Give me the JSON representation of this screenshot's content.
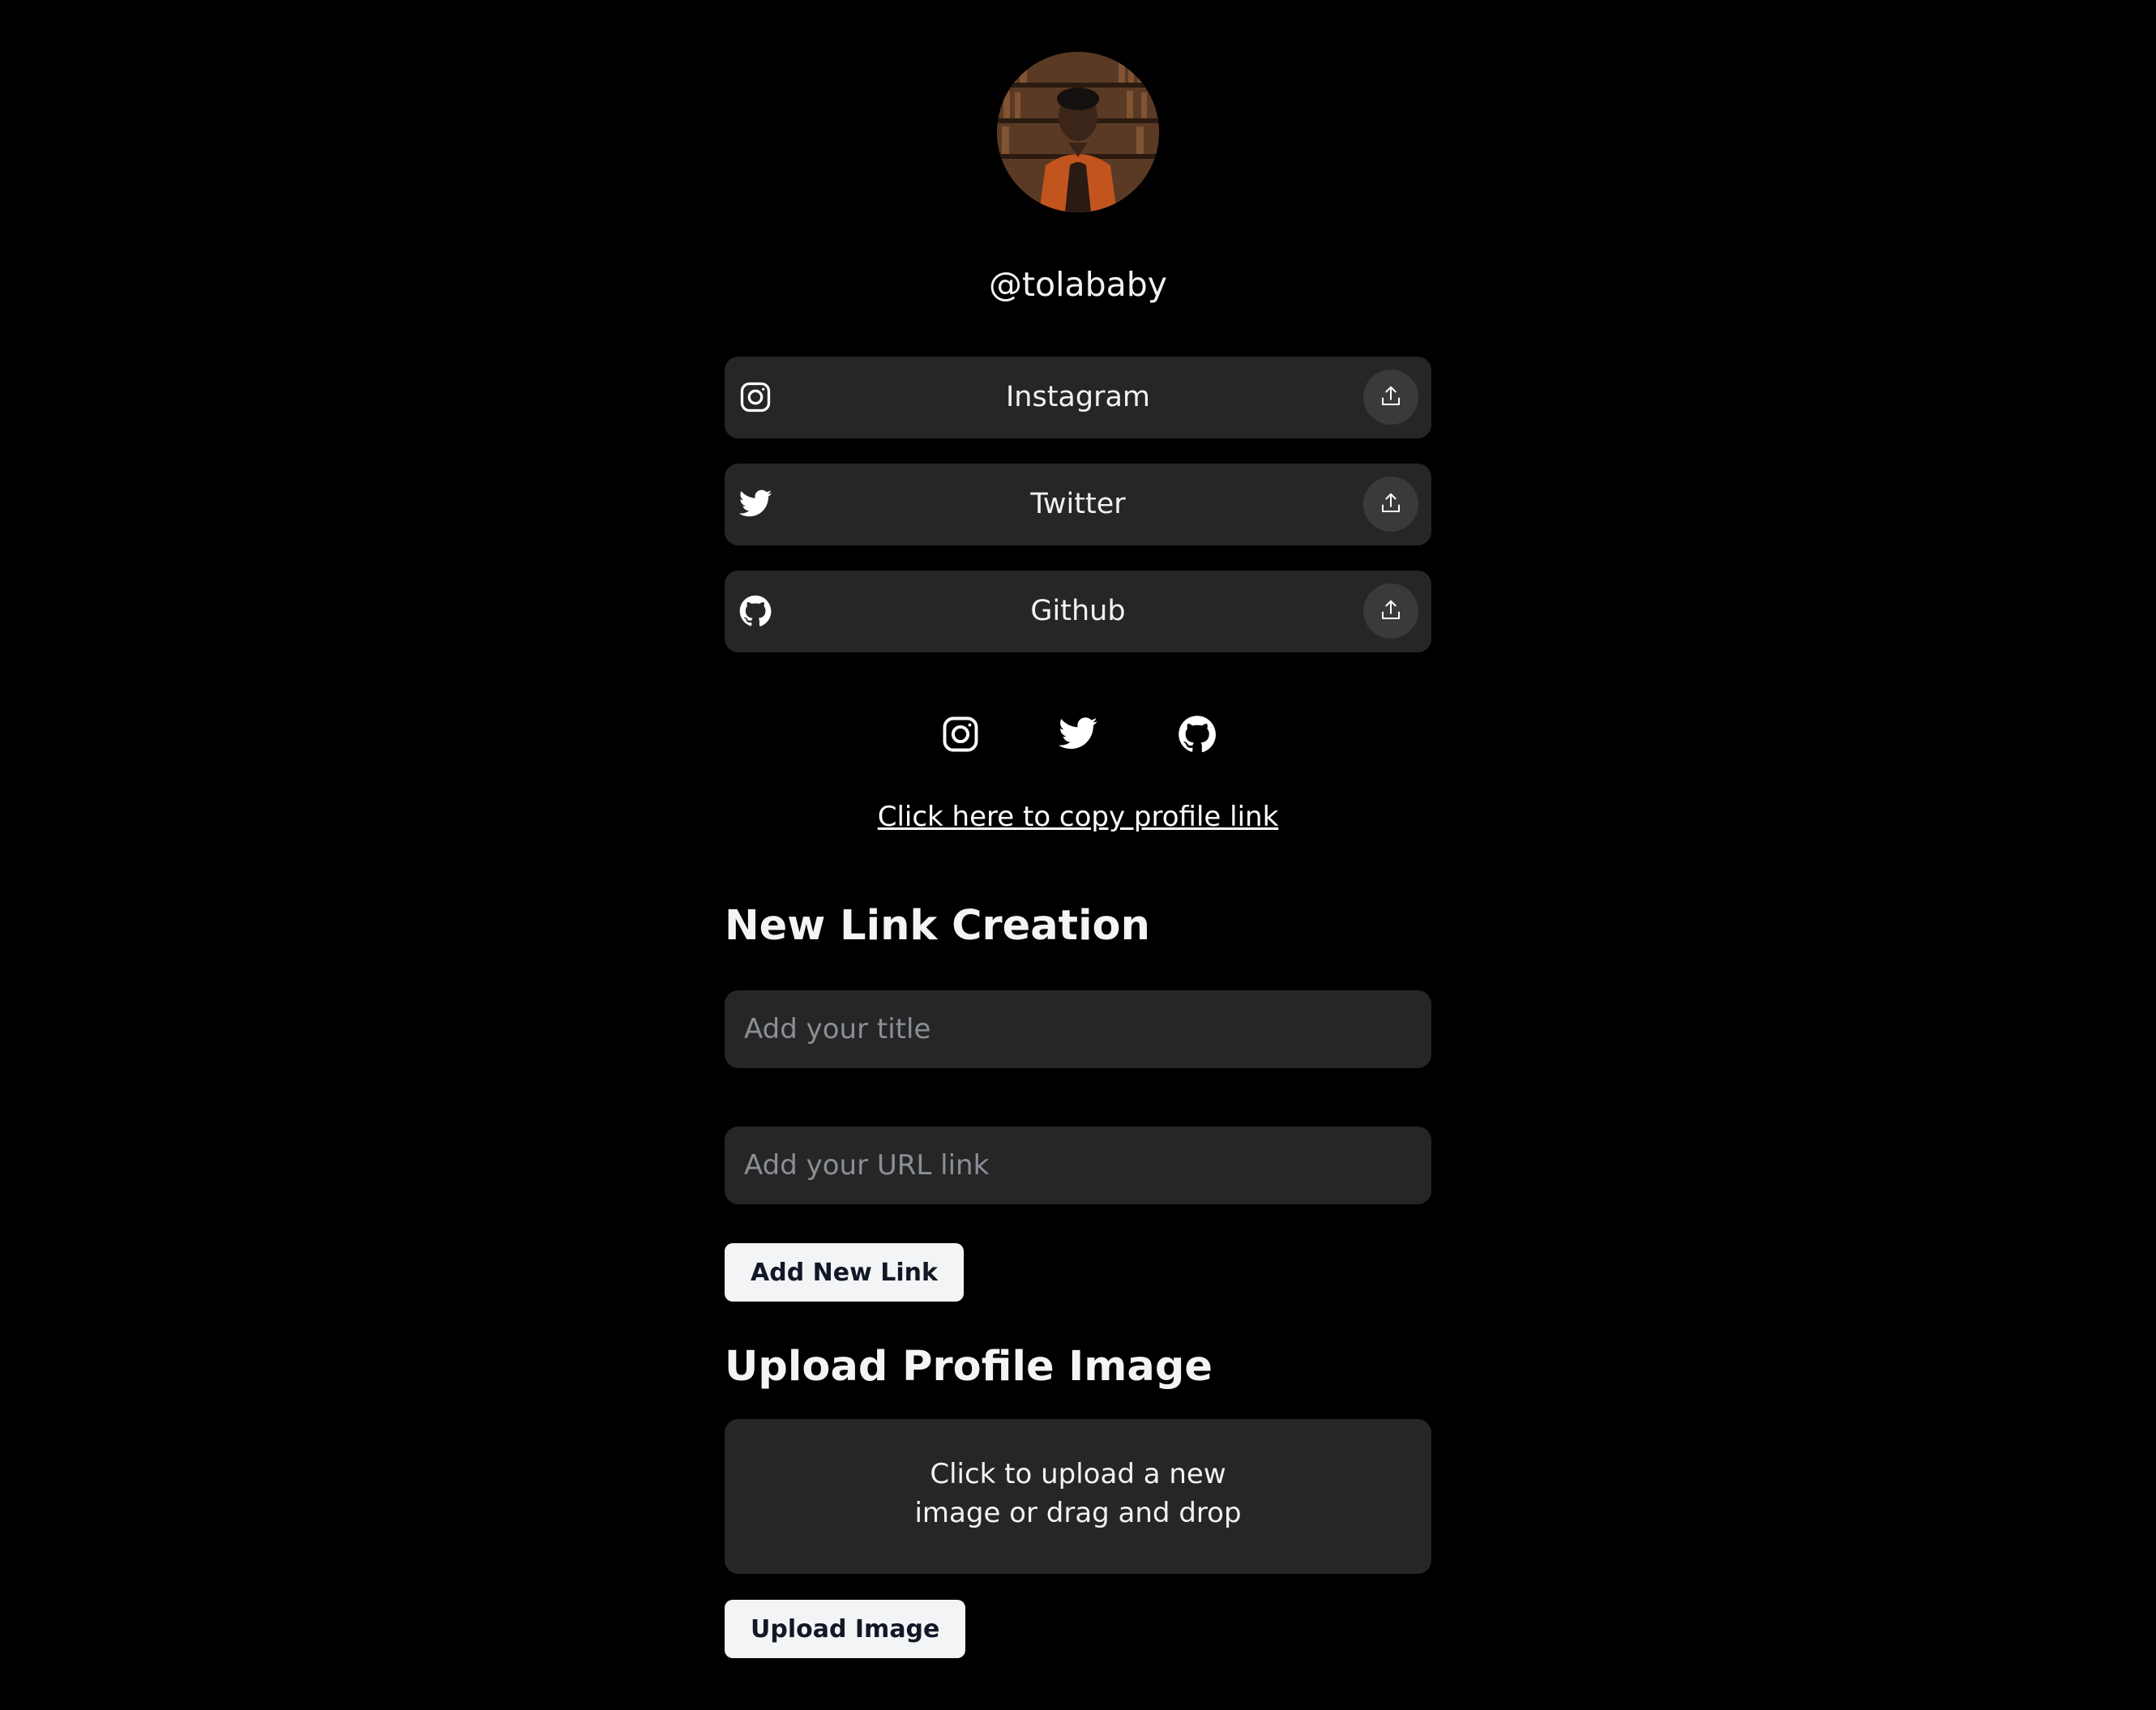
{
  "profile": {
    "username": "@tolababy"
  },
  "links": [
    {
      "label": "Instagram",
      "icon": "instagram-icon"
    },
    {
      "label": "Twitter",
      "icon": "twitter-icon"
    },
    {
      "label": "Github",
      "icon": "github-icon"
    }
  ],
  "social_icons": [
    "instagram-icon",
    "twitter-icon",
    "github-icon"
  ],
  "copy_link_text": "Click here to copy profile link",
  "new_link": {
    "heading": "New Link Creation",
    "title_placeholder": "Add your title",
    "url_placeholder": "Add your URL link",
    "button_label": "Add New Link"
  },
  "upload": {
    "heading": "Upload Profile Image",
    "dropzone_text": "Click to upload a new image or drag and drop",
    "button_label": "Upload Image"
  },
  "colors": {
    "background": "#000000",
    "card": "#262626",
    "button_bg": "#f3f4f6",
    "button_text": "#111827"
  }
}
